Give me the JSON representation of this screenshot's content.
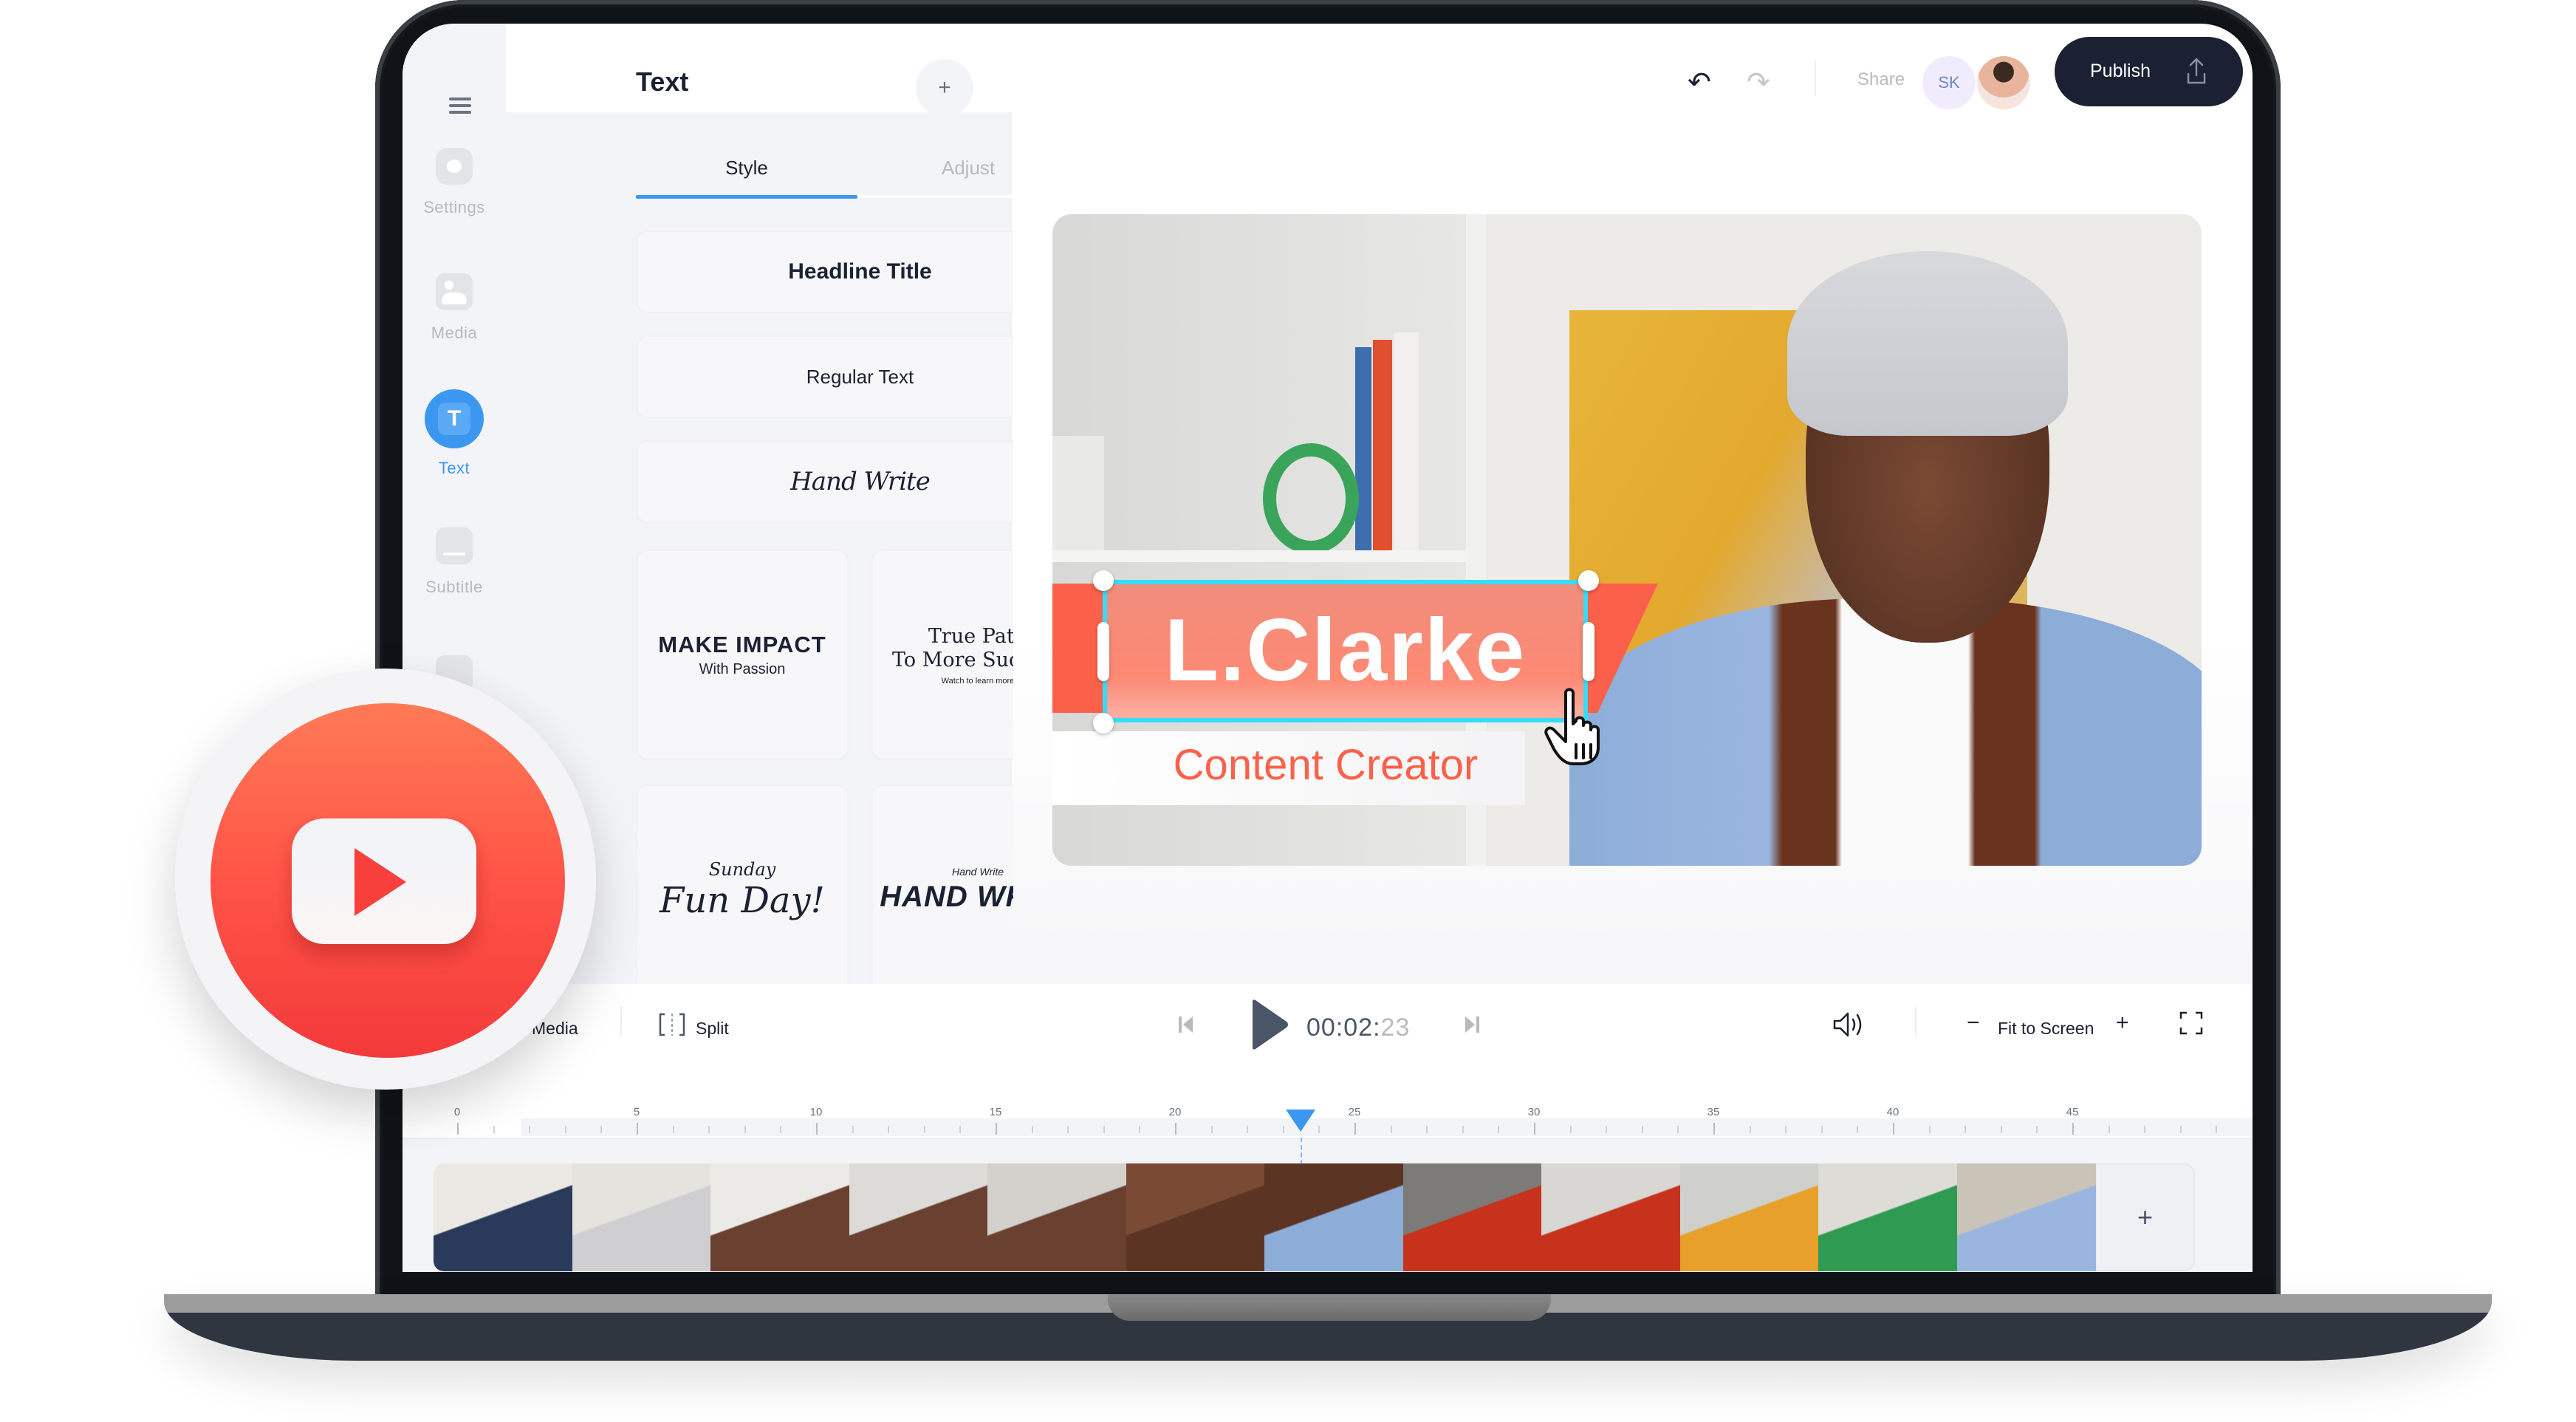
{
  "header": {
    "panel_title": "Text",
    "add_label": "+",
    "undo_icon": "undo-icon",
    "redo_icon": "redo-icon",
    "share_label": "Share",
    "collaborator_initials": "SK",
    "publish_label": "Publish"
  },
  "sidebar": {
    "items": [
      {
        "label": "Settings",
        "icon": "settings-icon",
        "active": false
      },
      {
        "label": "Media",
        "icon": "media-icon",
        "active": false
      },
      {
        "label": "Text",
        "icon": "text-icon",
        "active": true
      },
      {
        "label": "Subtitle",
        "icon": "subtitle-icon",
        "active": false
      }
    ]
  },
  "panel": {
    "tabs": [
      {
        "label": "Style",
        "active": true
      },
      {
        "label": "Adjust",
        "active": false
      }
    ],
    "styles": [
      {
        "label": "Headline Title"
      },
      {
        "label": "Regular Text"
      },
      {
        "label": "Hand Write"
      }
    ],
    "templates": [
      {
        "line1": "MAKE IMPACT",
        "line2": "With Passion"
      },
      {
        "line1": "True Path",
        "line2": "To More Success",
        "line3": "Watch to learn more"
      },
      {
        "line1": "Sunday",
        "line2": "Fun Day!"
      },
      {
        "line1": "Hand Write",
        "line2": "HAND WRITE"
      }
    ]
  },
  "preview": {
    "title_text": "L.Clarke",
    "subtitle_text": "Content Creator",
    "colors": {
      "ribbon": "#fb614a",
      "selection": "#37dcf9",
      "subtitle": "#fb614a"
    }
  },
  "controls": {
    "media_label": "Media",
    "split_label": "Split",
    "timecode_main": "00:02:",
    "timecode_frames": "23",
    "zoom_label": "Fit to Screen",
    "zoom_minus": "−",
    "zoom_plus": "+"
  },
  "timeline": {
    "tick_labels": [
      "0",
      "5",
      "10",
      "15",
      "20",
      "25",
      "30",
      "35",
      "40",
      "45"
    ],
    "playhead_seconds": 23.5,
    "add_clip_label": "+",
    "frame_count": 12
  },
  "badge": {
    "icon": "youtube-icon"
  },
  "colors": {
    "accent": "#3b97f0",
    "primary_dark": "#1b2133",
    "youtube_red": "#ff5447"
  }
}
